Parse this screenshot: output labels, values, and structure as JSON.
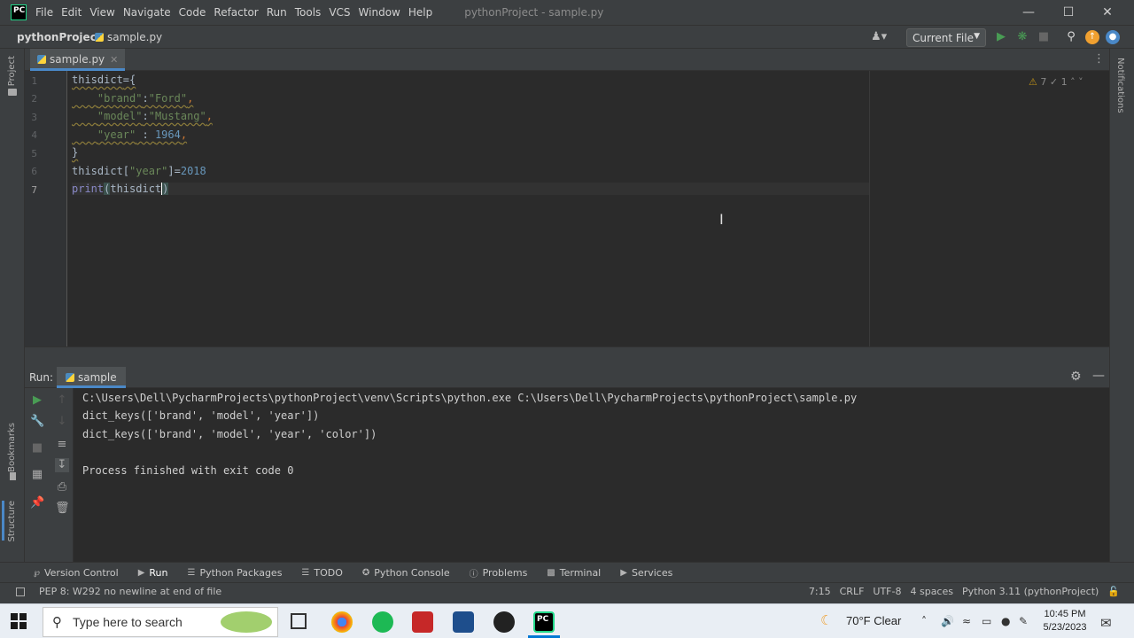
{
  "app": {
    "window_title": "pythonProject - sample.py",
    "logo_text": "PC"
  },
  "menu": [
    "File",
    "Edit",
    "View",
    "Navigate",
    "Code",
    "Refactor",
    "Run",
    "Tools",
    "VCS",
    "Window",
    "Help"
  ],
  "navbar": {
    "project": "pythonProject",
    "file": "sample.py",
    "run_config": "Current File"
  },
  "left_strip": {
    "project": "Project",
    "bookmarks": "Bookmarks",
    "structure": "Structure"
  },
  "right_strip": {
    "notifications": "Notifications"
  },
  "editor": {
    "tab": "sample.py",
    "inspection": {
      "warnings": "7",
      "weak_warnings": "1"
    },
    "line_numbers": [
      "1",
      "2",
      "3",
      "4",
      "5",
      "6",
      "7"
    ]
  },
  "run": {
    "label": "Run:",
    "tab": "sample",
    "console": [
      "C:\\Users\\Dell\\PycharmProjects\\pythonProject\\venv\\Scripts\\python.exe C:\\Users\\Dell\\PycharmProjects\\pythonProject\\sample.py",
      "dict_keys(['brand', 'model', 'year'])",
      "dict_keys(['brand', 'model', 'year', 'color'])",
      "",
      "Process finished with exit code 0"
    ]
  },
  "tool_windows": [
    "Version Control",
    "Run",
    "Python Packages",
    "TODO",
    "Python Console",
    "Problems",
    "Terminal",
    "Services"
  ],
  "status": {
    "message": "PEP 8: W292 no newline at end of file",
    "position": "7:15",
    "line_sep": "CRLF",
    "encoding": "UTF-8",
    "indent": "4 spaces",
    "interpreter": "Python 3.11 (pythonProject)"
  },
  "taskbar": {
    "search_placeholder": "Type here to search",
    "weather": "70°F  Clear",
    "time": "10:45 PM",
    "date": "5/23/2023"
  },
  "colors": {
    "accent": "#4a88c7",
    "string": "#6a8759",
    "number": "#6897bb",
    "run_green": "#499c54"
  }
}
